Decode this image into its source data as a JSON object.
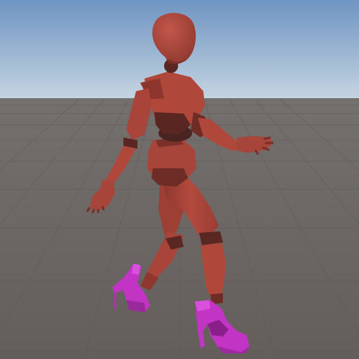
{
  "scene": {
    "view": "3d-game-viewport",
    "subject": "low-poly-mannequin",
    "pose": "walking",
    "colors": {
      "sky_top": "#6f95c2",
      "sky_horizon": "#c9d6e2",
      "ground": "#6b6562",
      "grid_line": "#5c5754",
      "body": "#b0473b",
      "body_shadow": "#6e2c26",
      "joint": "#4a2420",
      "shoes": "#c234c4",
      "shoes_shadow": "#8a1f8c"
    }
  }
}
